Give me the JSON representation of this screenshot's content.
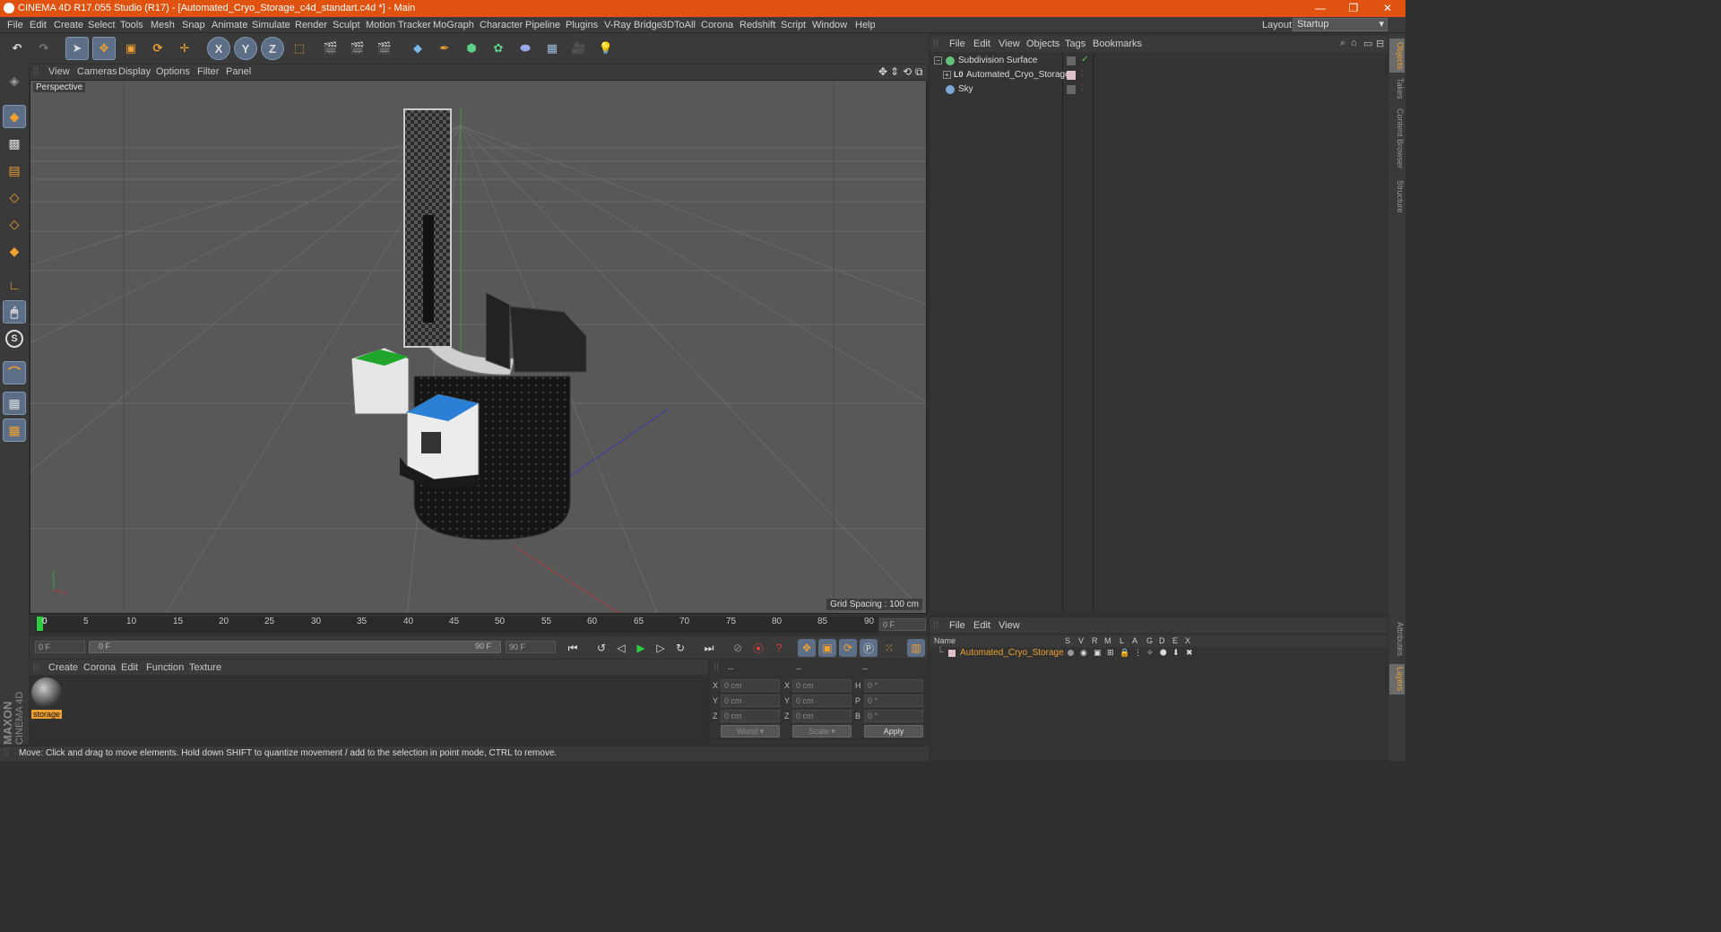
{
  "window": {
    "title": "CINEMA 4D R17.055 Studio (R17) - [Automated_Cryo_Storage_c4d_standart.c4d *] - Main",
    "controls": {
      "minimize": "—",
      "restore": "❐",
      "close": "✕"
    }
  },
  "menubar": {
    "items": [
      "File",
      "Edit",
      "Create",
      "Select",
      "Tools",
      "Mesh",
      "Snap",
      "Animate",
      "Simulate",
      "Render",
      "Sculpt",
      "Motion Tracker",
      "MoGraph",
      "Character",
      "Pipeline",
      "Plugins",
      "V-Ray Bridge",
      "3DToAll",
      "Corona",
      "Redshift",
      "Script",
      "Window",
      "Help"
    ],
    "layout_label": "Layout:",
    "layout_value": "Startup"
  },
  "toolbar": {
    "axis_x": "X",
    "axis_y": "Y",
    "axis_z": "Z"
  },
  "viewport": {
    "menu": [
      "View",
      "Cameras",
      "Display",
      "Options",
      "Filter",
      "Panel"
    ],
    "label": "Perspective",
    "grid_spacing": "Grid Spacing : 100 cm"
  },
  "timeline": {
    "ticks": [
      "0",
      "5",
      "10",
      "15",
      "20",
      "25",
      "30",
      "35",
      "40",
      "45",
      "50",
      "55",
      "60",
      "65",
      "70",
      "75",
      "80",
      "85",
      "90"
    ],
    "current_frame": "0 F"
  },
  "transport": {
    "start_frame": "0 F",
    "slider_start": "0 F",
    "slider_end": "90 F",
    "end_frame": "90 F"
  },
  "material_manager": {
    "menu": [
      "Create",
      "Corona",
      "Edit",
      "Function",
      "Texture"
    ],
    "materials": [
      {
        "name": "storage"
      }
    ]
  },
  "coordinates": {
    "headers": [
      "--",
      "--",
      "--"
    ],
    "rows": [
      {
        "l1": "X",
        "v1": "0 cm",
        "l2": "X",
        "v2": "0 cm",
        "l3": "H",
        "v3": "0 °"
      },
      {
        "l1": "Y",
        "v1": "0 cm",
        "l2": "Y",
        "v2": "0 cm",
        "l3": "P",
        "v3": "0 °"
      },
      {
        "l1": "Z",
        "v1": "0 cm",
        "l2": "Z",
        "v2": "0 cm",
        "l3": "B",
        "v3": "0 °"
      }
    ],
    "mode": "World",
    "scale": "Scale",
    "apply": "Apply"
  },
  "status": "Move: Click and drag to move elements. Hold down SHIFT to quantize movement / add to the selection in point mode, CTRL to remove.",
  "brand": {
    "maxon": "MAXON",
    "product": "CINEMA 4D"
  },
  "object_manager": {
    "menu": [
      "File",
      "Edit",
      "View",
      "Objects",
      "Tags",
      "Bookmarks"
    ],
    "objects": [
      {
        "name": "Subdivision Surface",
        "color": "#63c07a"
      },
      {
        "name": "Automated_Cryo_Storage",
        "color": "#e0c0c8"
      },
      {
        "name": "Sky",
        "color": "#7aa7d6"
      }
    ]
  },
  "layer_manager": {
    "menu": [
      "File",
      "Edit",
      "View"
    ],
    "columns": [
      "Name",
      "S",
      "V",
      "R",
      "M",
      "L",
      "A",
      "G",
      "D",
      "E",
      "X"
    ],
    "layers": [
      {
        "name": "Automated_Cryo_Storage",
        "color": "#f0a030"
      }
    ]
  },
  "side_tabs": {
    "top": [
      "Objects",
      "Takes",
      "Content Browser",
      "Structure"
    ],
    "bottom": [
      "Attributes",
      "Layers"
    ]
  }
}
